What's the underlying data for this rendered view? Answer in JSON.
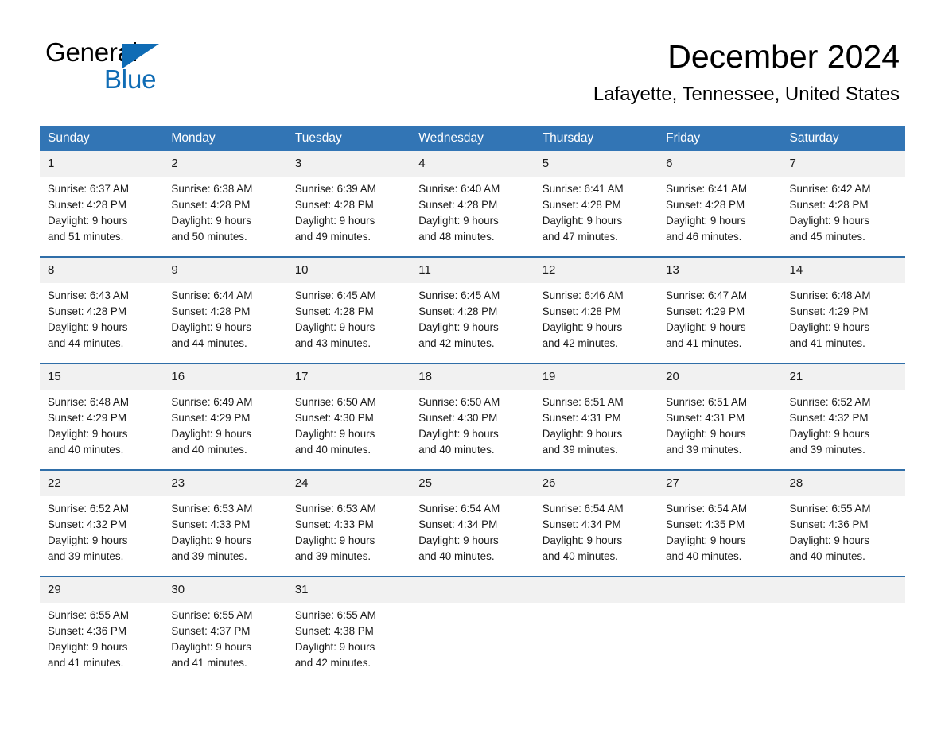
{
  "brand": {
    "logo_line1": "General",
    "logo_line2": "Blue",
    "accent_color": "#0f6cb5",
    "triangle_icon": "triangle-icon"
  },
  "header": {
    "month_title": "December 2024",
    "location": "Lafayette, Tennessee, United States"
  },
  "calendar": {
    "header_bg": "#3275b5",
    "daynum_bg": "#f1f1f1",
    "row_rule_color": "#2f6ea8",
    "weekday_headers": [
      "Sunday",
      "Monday",
      "Tuesday",
      "Wednesday",
      "Thursday",
      "Friday",
      "Saturday"
    ],
    "weeks": [
      [
        {
          "day": "1",
          "sunrise": "Sunrise: 6:37 AM",
          "sunset": "Sunset: 4:28 PM",
          "daylight_line1": "Daylight: 9 hours",
          "daylight_line2": "and 51 minutes."
        },
        {
          "day": "2",
          "sunrise": "Sunrise: 6:38 AM",
          "sunset": "Sunset: 4:28 PM",
          "daylight_line1": "Daylight: 9 hours",
          "daylight_line2": "and 50 minutes."
        },
        {
          "day": "3",
          "sunrise": "Sunrise: 6:39 AM",
          "sunset": "Sunset: 4:28 PM",
          "daylight_line1": "Daylight: 9 hours",
          "daylight_line2": "and 49 minutes."
        },
        {
          "day": "4",
          "sunrise": "Sunrise: 6:40 AM",
          "sunset": "Sunset: 4:28 PM",
          "daylight_line1": "Daylight: 9 hours",
          "daylight_line2": "and 48 minutes."
        },
        {
          "day": "5",
          "sunrise": "Sunrise: 6:41 AM",
          "sunset": "Sunset: 4:28 PM",
          "daylight_line1": "Daylight: 9 hours",
          "daylight_line2": "and 47 minutes."
        },
        {
          "day": "6",
          "sunrise": "Sunrise: 6:41 AM",
          "sunset": "Sunset: 4:28 PM",
          "daylight_line1": "Daylight: 9 hours",
          "daylight_line2": "and 46 minutes."
        },
        {
          "day": "7",
          "sunrise": "Sunrise: 6:42 AM",
          "sunset": "Sunset: 4:28 PM",
          "daylight_line1": "Daylight: 9 hours",
          "daylight_line2": "and 45 minutes."
        }
      ],
      [
        {
          "day": "8",
          "sunrise": "Sunrise: 6:43 AM",
          "sunset": "Sunset: 4:28 PM",
          "daylight_line1": "Daylight: 9 hours",
          "daylight_line2": "and 44 minutes."
        },
        {
          "day": "9",
          "sunrise": "Sunrise: 6:44 AM",
          "sunset": "Sunset: 4:28 PM",
          "daylight_line1": "Daylight: 9 hours",
          "daylight_line2": "and 44 minutes."
        },
        {
          "day": "10",
          "sunrise": "Sunrise: 6:45 AM",
          "sunset": "Sunset: 4:28 PM",
          "daylight_line1": "Daylight: 9 hours",
          "daylight_line2": "and 43 minutes."
        },
        {
          "day": "11",
          "sunrise": "Sunrise: 6:45 AM",
          "sunset": "Sunset: 4:28 PM",
          "daylight_line1": "Daylight: 9 hours",
          "daylight_line2": "and 42 minutes."
        },
        {
          "day": "12",
          "sunrise": "Sunrise: 6:46 AM",
          "sunset": "Sunset: 4:28 PM",
          "daylight_line1": "Daylight: 9 hours",
          "daylight_line2": "and 42 minutes."
        },
        {
          "day": "13",
          "sunrise": "Sunrise: 6:47 AM",
          "sunset": "Sunset: 4:29 PM",
          "daylight_line1": "Daylight: 9 hours",
          "daylight_line2": "and 41 minutes."
        },
        {
          "day": "14",
          "sunrise": "Sunrise: 6:48 AM",
          "sunset": "Sunset: 4:29 PM",
          "daylight_line1": "Daylight: 9 hours",
          "daylight_line2": "and 41 minutes."
        }
      ],
      [
        {
          "day": "15",
          "sunrise": "Sunrise: 6:48 AM",
          "sunset": "Sunset: 4:29 PM",
          "daylight_line1": "Daylight: 9 hours",
          "daylight_line2": "and 40 minutes."
        },
        {
          "day": "16",
          "sunrise": "Sunrise: 6:49 AM",
          "sunset": "Sunset: 4:29 PM",
          "daylight_line1": "Daylight: 9 hours",
          "daylight_line2": "and 40 minutes."
        },
        {
          "day": "17",
          "sunrise": "Sunrise: 6:50 AM",
          "sunset": "Sunset: 4:30 PM",
          "daylight_line1": "Daylight: 9 hours",
          "daylight_line2": "and 40 minutes."
        },
        {
          "day": "18",
          "sunrise": "Sunrise: 6:50 AM",
          "sunset": "Sunset: 4:30 PM",
          "daylight_line1": "Daylight: 9 hours",
          "daylight_line2": "and 40 minutes."
        },
        {
          "day": "19",
          "sunrise": "Sunrise: 6:51 AM",
          "sunset": "Sunset: 4:31 PM",
          "daylight_line1": "Daylight: 9 hours",
          "daylight_line2": "and 39 minutes."
        },
        {
          "day": "20",
          "sunrise": "Sunrise: 6:51 AM",
          "sunset": "Sunset: 4:31 PM",
          "daylight_line1": "Daylight: 9 hours",
          "daylight_line2": "and 39 minutes."
        },
        {
          "day": "21",
          "sunrise": "Sunrise: 6:52 AM",
          "sunset": "Sunset: 4:32 PM",
          "daylight_line1": "Daylight: 9 hours",
          "daylight_line2": "and 39 minutes."
        }
      ],
      [
        {
          "day": "22",
          "sunrise": "Sunrise: 6:52 AM",
          "sunset": "Sunset: 4:32 PM",
          "daylight_line1": "Daylight: 9 hours",
          "daylight_line2": "and 39 minutes."
        },
        {
          "day": "23",
          "sunrise": "Sunrise: 6:53 AM",
          "sunset": "Sunset: 4:33 PM",
          "daylight_line1": "Daylight: 9 hours",
          "daylight_line2": "and 39 minutes."
        },
        {
          "day": "24",
          "sunrise": "Sunrise: 6:53 AM",
          "sunset": "Sunset: 4:33 PM",
          "daylight_line1": "Daylight: 9 hours",
          "daylight_line2": "and 39 minutes."
        },
        {
          "day": "25",
          "sunrise": "Sunrise: 6:54 AM",
          "sunset": "Sunset: 4:34 PM",
          "daylight_line1": "Daylight: 9 hours",
          "daylight_line2": "and 40 minutes."
        },
        {
          "day": "26",
          "sunrise": "Sunrise: 6:54 AM",
          "sunset": "Sunset: 4:34 PM",
          "daylight_line1": "Daylight: 9 hours",
          "daylight_line2": "and 40 minutes."
        },
        {
          "day": "27",
          "sunrise": "Sunrise: 6:54 AM",
          "sunset": "Sunset: 4:35 PM",
          "daylight_line1": "Daylight: 9 hours",
          "daylight_line2": "and 40 minutes."
        },
        {
          "day": "28",
          "sunrise": "Sunrise: 6:55 AM",
          "sunset": "Sunset: 4:36 PM",
          "daylight_line1": "Daylight: 9 hours",
          "daylight_line2": "and 40 minutes."
        }
      ],
      [
        {
          "day": "29",
          "sunrise": "Sunrise: 6:55 AM",
          "sunset": "Sunset: 4:36 PM",
          "daylight_line1": "Daylight: 9 hours",
          "daylight_line2": "and 41 minutes."
        },
        {
          "day": "30",
          "sunrise": "Sunrise: 6:55 AM",
          "sunset": "Sunset: 4:37 PM",
          "daylight_line1": "Daylight: 9 hours",
          "daylight_line2": "and 41 minutes."
        },
        {
          "day": "31",
          "sunrise": "Sunrise: 6:55 AM",
          "sunset": "Sunset: 4:38 PM",
          "daylight_line1": "Daylight: 9 hours",
          "daylight_line2": "and 42 minutes."
        },
        {
          "day": "",
          "sunrise": "",
          "sunset": "",
          "daylight_line1": "",
          "daylight_line2": ""
        },
        {
          "day": "",
          "sunrise": "",
          "sunset": "",
          "daylight_line1": "",
          "daylight_line2": ""
        },
        {
          "day": "",
          "sunrise": "",
          "sunset": "",
          "daylight_line1": "",
          "daylight_line2": ""
        },
        {
          "day": "",
          "sunrise": "",
          "sunset": "",
          "daylight_line1": "",
          "daylight_line2": ""
        }
      ]
    ]
  }
}
